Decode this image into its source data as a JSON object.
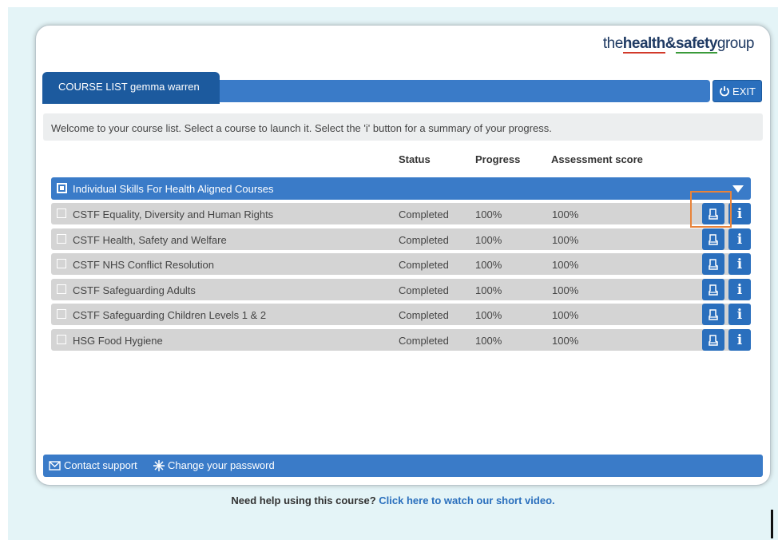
{
  "logo": {
    "the": "the",
    "health": "health",
    "amp": "&",
    "safety": "safety",
    "group": "group"
  },
  "header": {
    "tab_label": "COURSE LIST gemma warren",
    "exit_label": "EXIT"
  },
  "welcome_text": "Welcome to your course list. Select a course to launch it. Select the 'i' button for a summary of your progress.",
  "columns": {
    "status": "Status",
    "progress": "Progress",
    "score": "Assessment score"
  },
  "group": {
    "label": "Individual Skills For Health Aligned Courses"
  },
  "courses": [
    {
      "name": "CSTF Equality, Diversity and Human Rights",
      "status": "Completed",
      "progress": "100%",
      "score": "100%"
    },
    {
      "name": "CSTF Health, Safety and Welfare",
      "status": "Completed",
      "progress": "100%",
      "score": "100%"
    },
    {
      "name": "CSTF NHS Conflict Resolution",
      "status": "Completed",
      "progress": "100%",
      "score": "100%"
    },
    {
      "name": "CSTF Safeguarding Adults",
      "status": "Completed",
      "progress": "100%",
      "score": "100%"
    },
    {
      "name": "CSTF Safeguarding Children Levels 1 & 2",
      "status": "Completed",
      "progress": "100%",
      "score": "100%"
    },
    {
      "name": "HSG Food Hygiene",
      "status": "Completed",
      "progress": "100%",
      "score": "100%"
    }
  ],
  "info_glyph": "i",
  "footer": {
    "contact": "Contact support",
    "password": "Change your password"
  },
  "help": {
    "text": "Need help using this course?",
    "link": "Click here to watch our short video."
  },
  "colors": {
    "primary": "#3a7bc8",
    "dark_tab": "#1c5a9e",
    "highlight": "#e8833a",
    "row_bg": "#d4d4d4"
  },
  "icons": {
    "exit": "power-icon",
    "certificate": "certificate-icon",
    "info": "info-icon",
    "contact": "envelope-icon",
    "password": "asterisk-icon",
    "group_toggle": "triangle-down-icon"
  }
}
